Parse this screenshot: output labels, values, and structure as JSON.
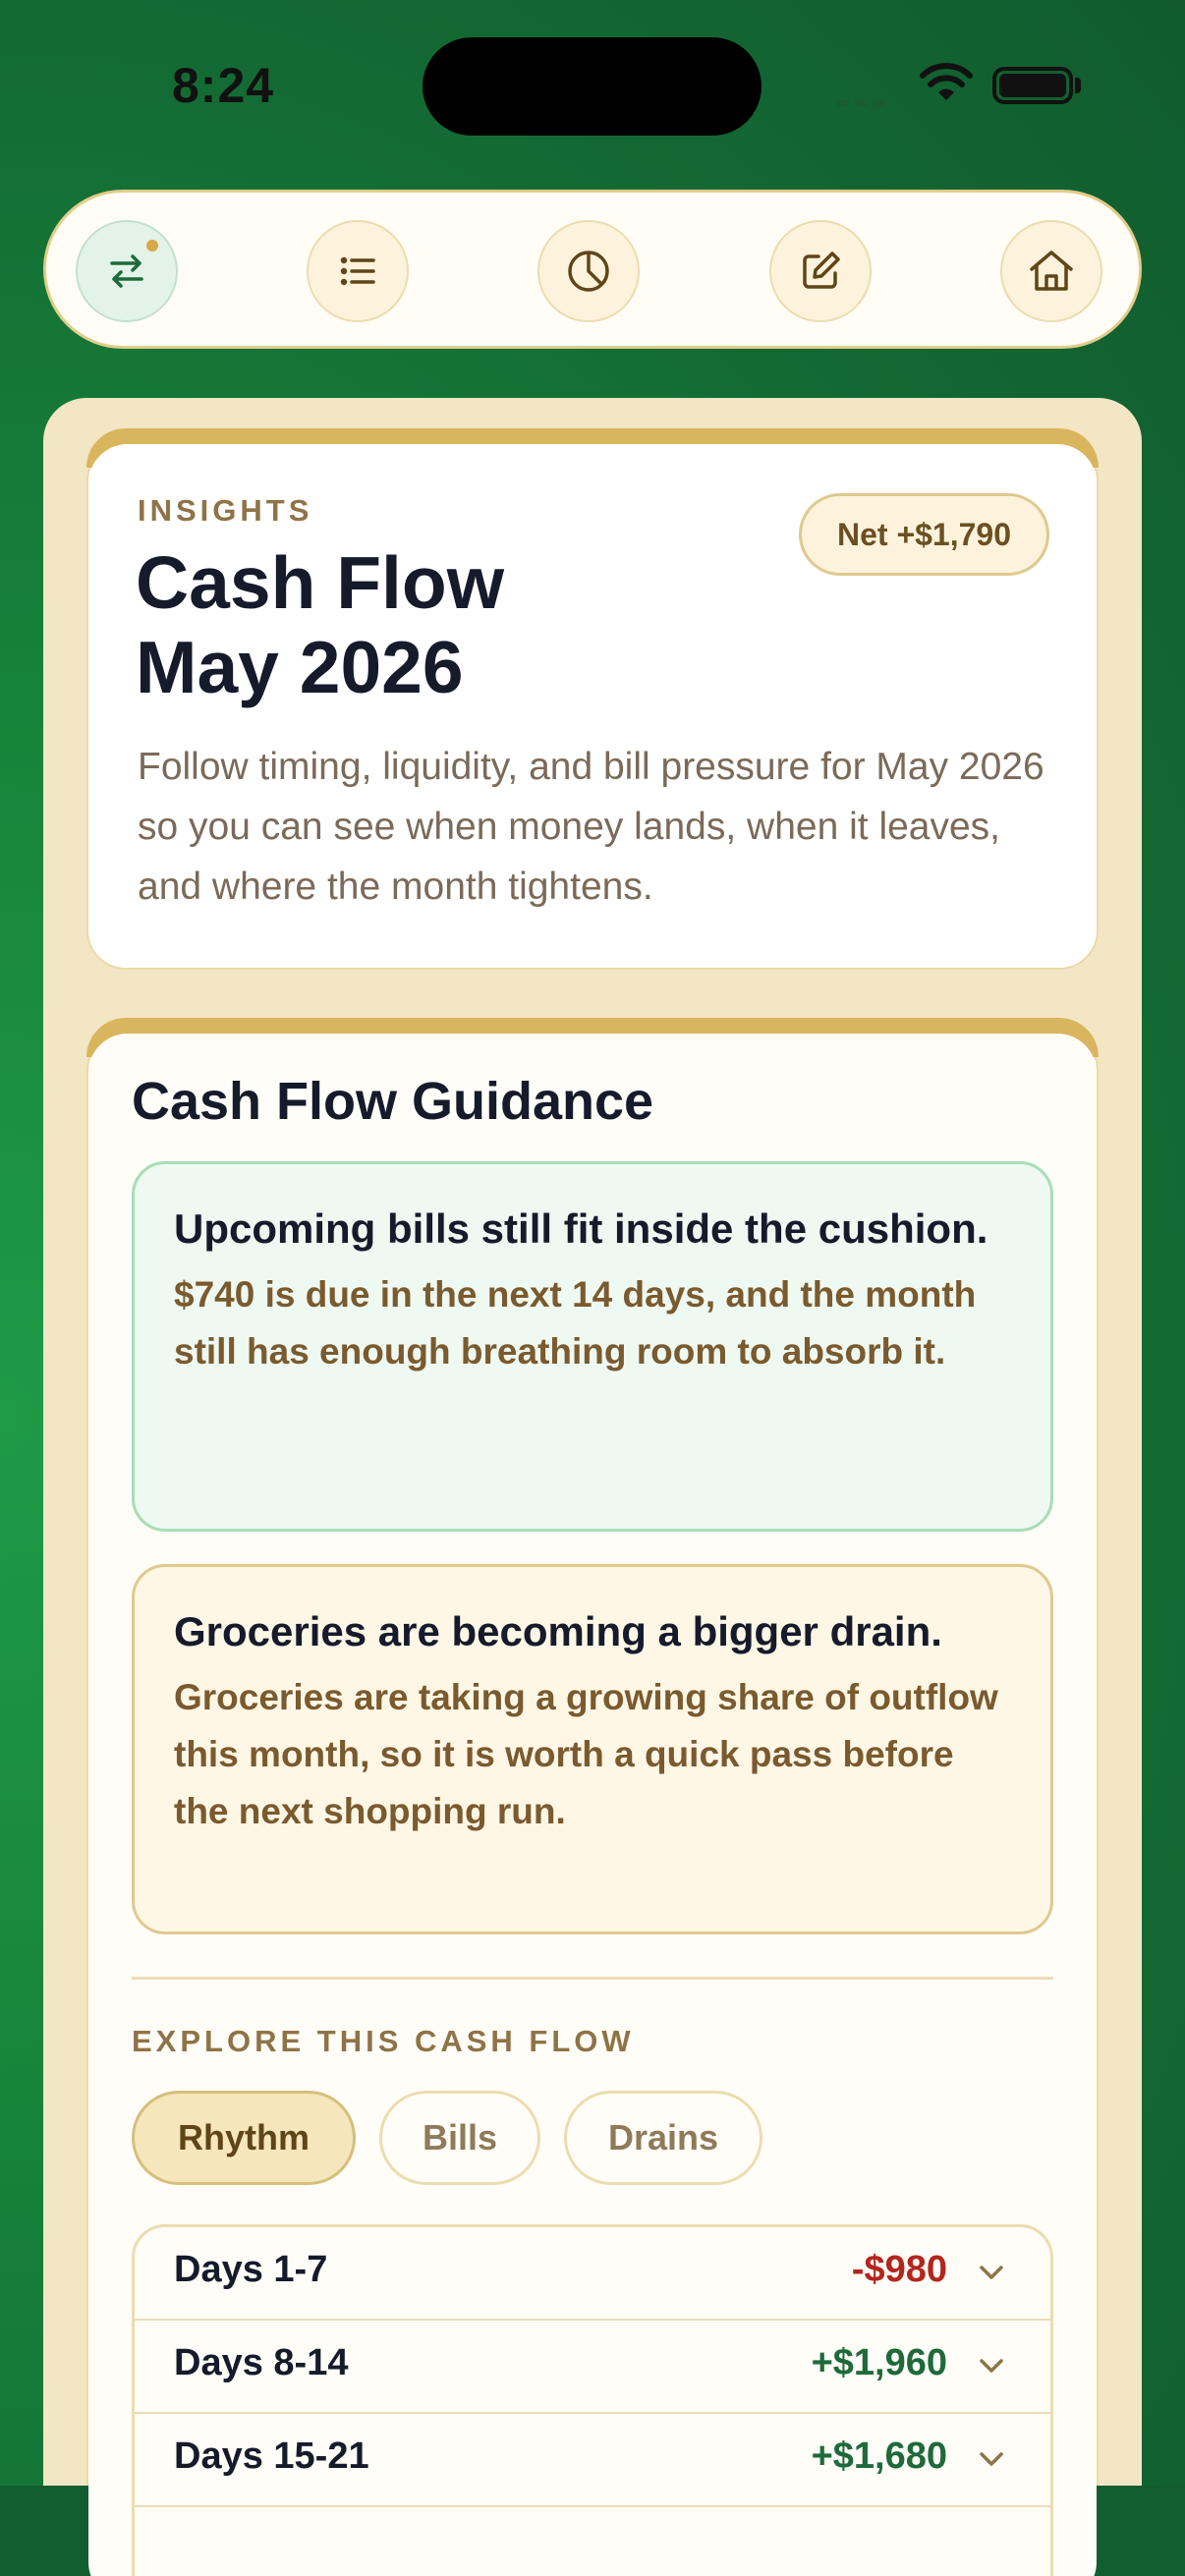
{
  "status_bar": {
    "time": "8:24"
  },
  "nav": {
    "items": [
      {
        "icon": "transfer-arrows-icon",
        "active": true
      },
      {
        "icon": "list-icon",
        "active": false
      },
      {
        "icon": "pie-chart-icon",
        "active": false
      },
      {
        "icon": "edit-icon",
        "active": false
      },
      {
        "icon": "home-icon",
        "active": false
      }
    ]
  },
  "insights": {
    "eyebrow": "INSIGHTS",
    "title_line1": "Cash Flow",
    "title_line2": "May 2026",
    "net_badge": "Net +$1,790",
    "description": "Follow timing, liquidity, and bill pressure for May 2026 so you can see when money lands, when it leaves, and where the month tightens."
  },
  "guidance": {
    "title": "Cash Flow Guidance",
    "callouts": [
      {
        "tone": "good",
        "heading": "Upcoming bills still fit inside the cushion.",
        "body": "$740 is due in the next 14 days, and the month still has enough breathing room to absorb it."
      },
      {
        "tone": "warn",
        "heading": "Groceries are becoming a bigger drain.",
        "body": "Groceries are taking a growing share of outflow this month, so it is worth a quick pass before the next shopping run."
      }
    ],
    "explore_label": "EXPLORE THIS CASH FLOW",
    "tabs": [
      {
        "label": "Rhythm",
        "active": true
      },
      {
        "label": "Bills",
        "active": false
      },
      {
        "label": "Drains",
        "active": false
      }
    ],
    "rows": [
      {
        "label": "Days 1-7",
        "amount": "-$980",
        "direction": "negative"
      },
      {
        "label": "Days 8-14",
        "amount": "+$1,960",
        "direction": "positive"
      },
      {
        "label": "Days 15-21",
        "amount": "+$1,680",
        "direction": "positive"
      }
    ]
  },
  "colors": {
    "background_green": "#17833a",
    "accent_gold": "#d9b55e",
    "negative_red": "#b3261e",
    "positive_green": "#1e6a3a"
  }
}
